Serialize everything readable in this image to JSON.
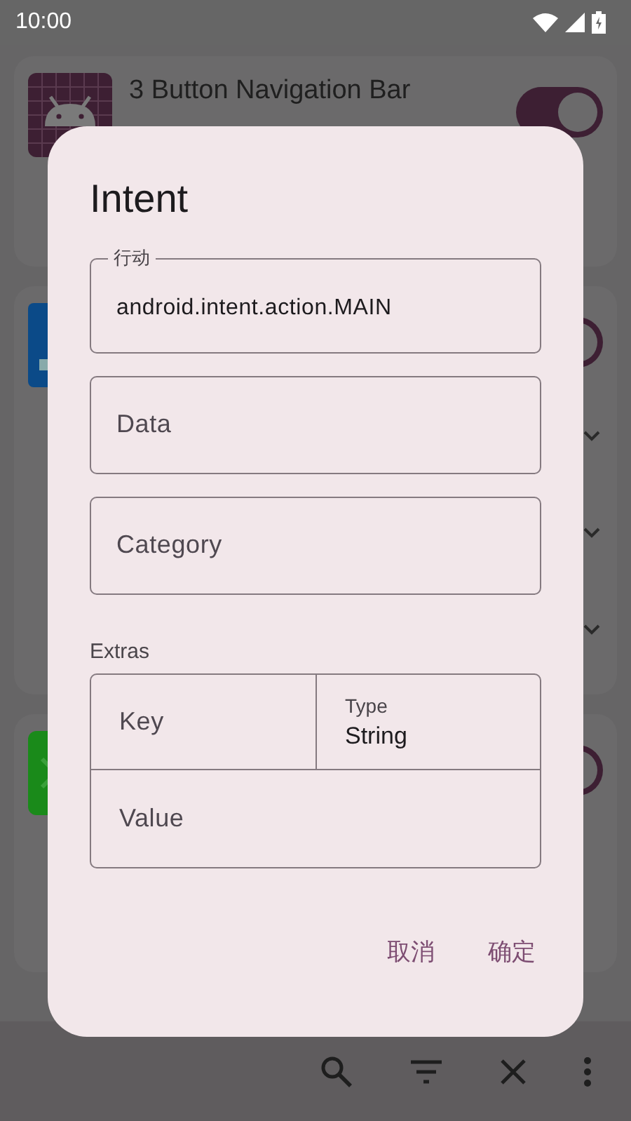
{
  "status_bar": {
    "time": "10:00"
  },
  "app_list": [
    {
      "title": "3 Button Navigation Bar",
      "switch_on": true
    },
    {
      "switch_on": true,
      "rows": [
        {
          "expanded": false
        },
        {
          "expanded": false
        },
        {
          "expanded": false
        }
      ]
    },
    {
      "switch_on": true
    }
  ],
  "dialog": {
    "title": "Intent",
    "fields": [
      {
        "label": "行动",
        "value": "android.intent.action.MAIN"
      },
      {
        "placeholder": "Data"
      },
      {
        "placeholder": "Category"
      }
    ],
    "extras": {
      "label": "Extras",
      "key_placeholder": "Key",
      "type_label": "Type",
      "type_value": "String",
      "value_placeholder": "Value"
    },
    "buttons": [
      "取消",
      "确定"
    ]
  }
}
